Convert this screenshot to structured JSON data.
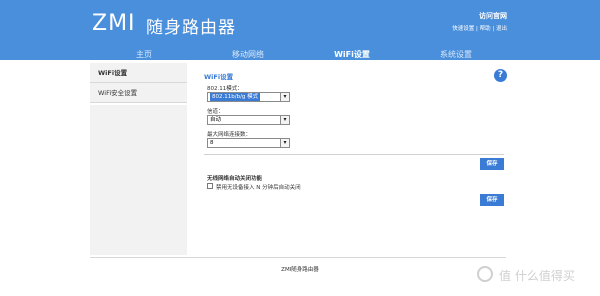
{
  "header": {
    "logo_mark": "ZMI",
    "logo_text": "随身路由器",
    "top_title": "访问官网",
    "top_links": [
      "快速设置",
      "帮助",
      "退出"
    ],
    "bg_color": "#4a8fdc"
  },
  "nav": {
    "tabs": [
      {
        "label": "主页",
        "active": false
      },
      {
        "label": "移动网络",
        "active": false
      },
      {
        "label": "WiFi设置",
        "active": true
      },
      {
        "label": "系统设置",
        "active": false
      }
    ]
  },
  "sidebar": {
    "items": [
      {
        "label": "WiFi设置",
        "active": true
      },
      {
        "label": "WiFi安全设置",
        "active": false
      }
    ]
  },
  "main": {
    "section_title": "WiFi设置",
    "help_icon": "question-icon",
    "fields": [
      {
        "label": "802.11模式：",
        "value": "802.11b/b/g 模式"
      },
      {
        "label": "信道：",
        "value": "自动"
      },
      {
        "label": "最大网络连接数：",
        "value": "8"
      }
    ],
    "save_label": "保存",
    "auto_off": {
      "title": "无线网络自动关闭功能",
      "checkbox_label": "禁用无设备接入 N 分钟后自动关闭",
      "checked": false
    },
    "save_label_2": "保存"
  },
  "footer": {
    "text": "ZMI随身路由器"
  },
  "watermark": {
    "text": "值 什么值得买"
  }
}
